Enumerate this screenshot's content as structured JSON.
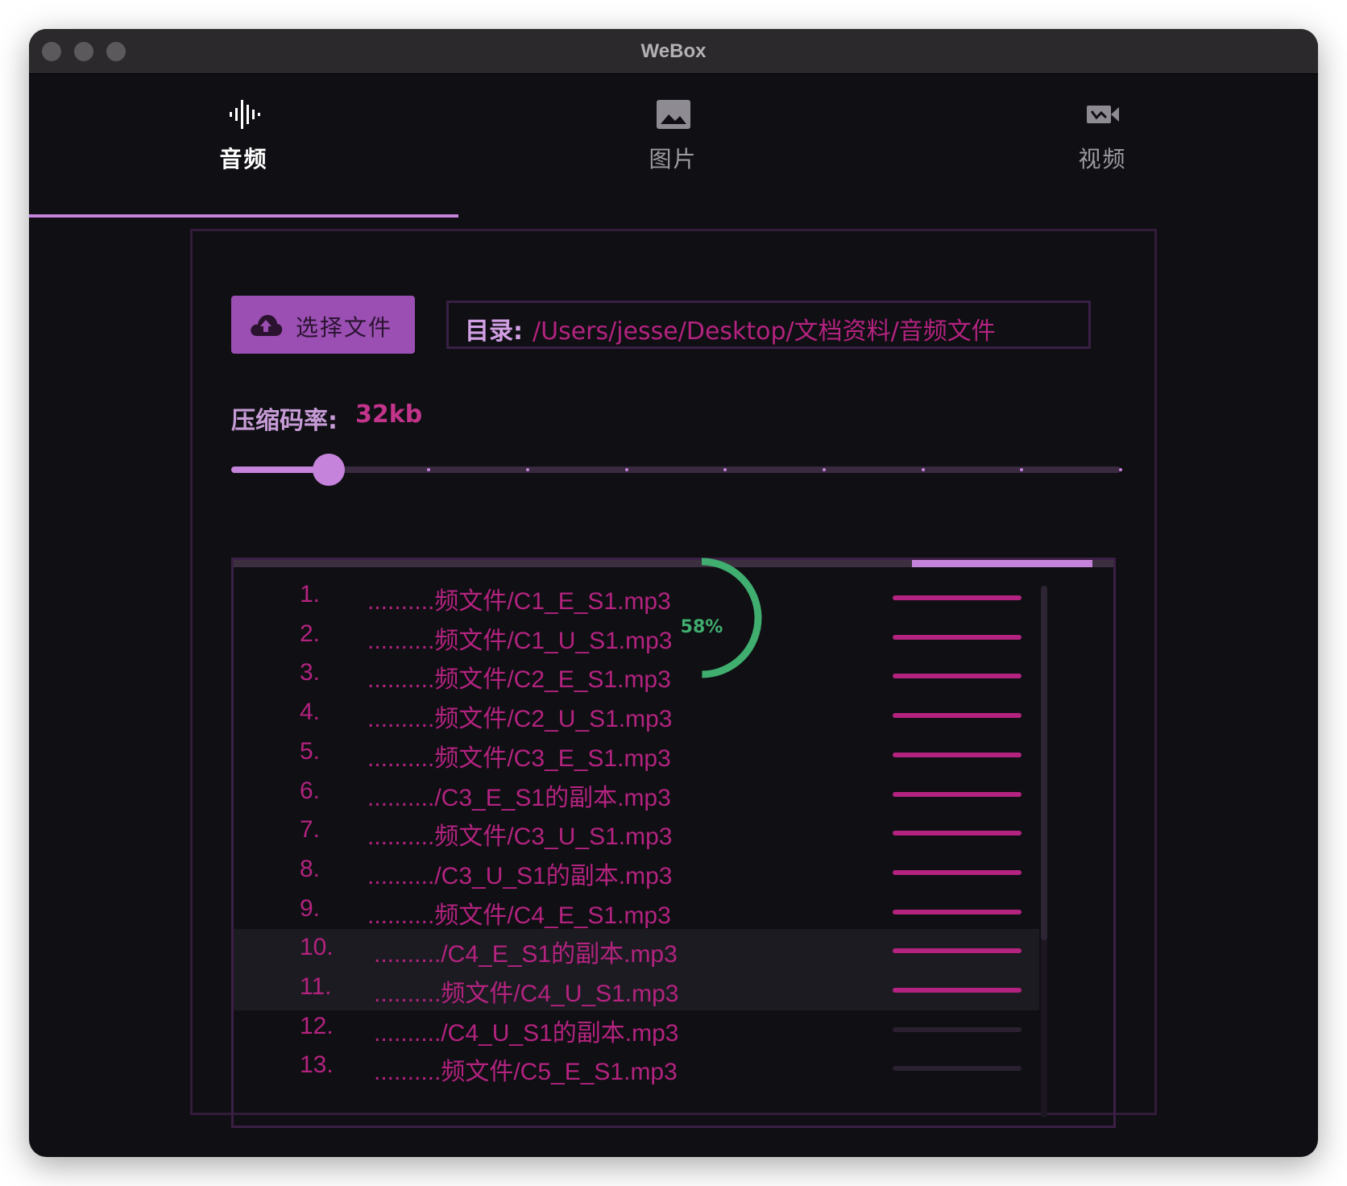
{
  "window": {
    "title": "WeBox"
  },
  "tabs": [
    {
      "label": "音频",
      "icon": "audio-wave-icon",
      "active": true
    },
    {
      "label": "图片",
      "icon": "image-icon",
      "active": false
    },
    {
      "label": "视频",
      "icon": "video-camera-icon",
      "active": false
    }
  ],
  "picker": {
    "button_label": "选择文件",
    "icon": "cloud-upload-icon"
  },
  "directory": {
    "label": "目录:",
    "path": "/Users/jesse/Desktop/文档资料/音频文件"
  },
  "bitrate": {
    "label": "压缩码率:",
    "value": "32kb",
    "slider_fraction": 0.11
  },
  "files": [
    {
      "index": "1.",
      "name": "..........频文件/C1_E_S1.mp3",
      "progress": 1
    },
    {
      "index": "2.",
      "name": "..........频文件/C1_U_S1.mp3",
      "progress": 1
    },
    {
      "index": "3.",
      "name": "..........频文件/C2_E_S1.mp3",
      "progress": 1
    },
    {
      "index": "4.",
      "name": "..........频文件/C2_U_S1.mp3",
      "progress": 1
    },
    {
      "index": "5.",
      "name": "..........频文件/C3_E_S1.mp3",
      "progress": 1
    },
    {
      "index": "6.",
      "name": "........../C3_E_S1的副本.mp3",
      "progress": 1
    },
    {
      "index": "7.",
      "name": "..........频文件/C3_U_S1.mp3",
      "progress": 1
    },
    {
      "index": "8.",
      "name": "........../C3_U_S1的副本.mp3",
      "progress": 1
    },
    {
      "index": "9.",
      "name": "..........频文件/C4_E_S1.mp3",
      "progress": 1
    },
    {
      "index": "10.",
      "name": "........../C4_E_S1的副本.mp3",
      "progress": 1
    },
    {
      "index": "11.",
      "name": "..........频文件/C4_U_S1.mp3",
      "progress": 1
    },
    {
      "index": "12.",
      "name": "........../C4_U_S1的副本.mp3",
      "progress": 0
    },
    {
      "index": "13.",
      "name": "..........频文件/C5_E_S1.mp3",
      "progress": 0
    }
  ],
  "overall_progress": {
    "text": "58%",
    "fraction": 0.58
  },
  "colors": {
    "accent": "#c583dc",
    "button": "#9b4fb3",
    "text_magenta": "#b3237f",
    "progress_green": "#3fae6e",
    "background": "#0f0f14"
  }
}
